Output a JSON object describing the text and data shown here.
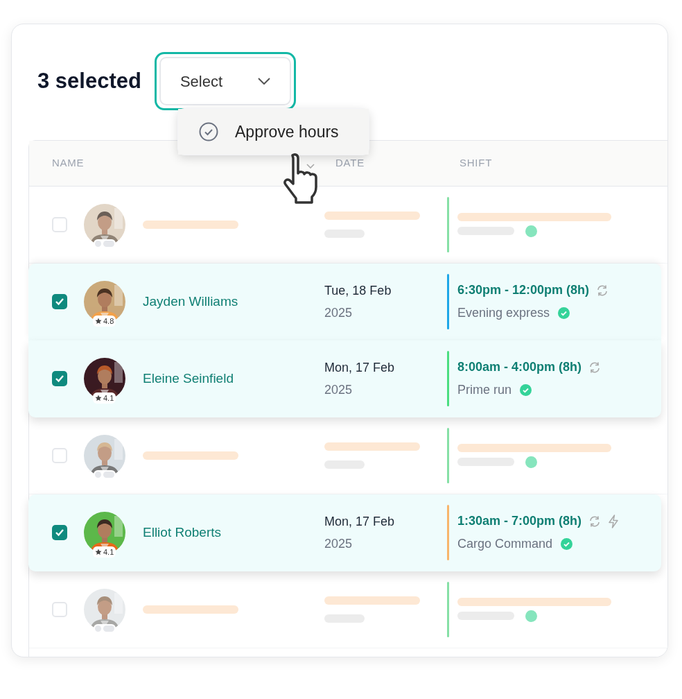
{
  "heading": "3 selected",
  "select": {
    "label": "Select",
    "focused": true
  },
  "menu": {
    "items": [
      {
        "label": "Approve hours"
      }
    ]
  },
  "table": {
    "columns": [
      {
        "label": "NAME"
      },
      {
        "label": "DATE"
      },
      {
        "label": "SHIFT"
      }
    ],
    "rows": [
      {
        "kind": "placeholder",
        "selected": false,
        "color": "#86e0a6"
      },
      {
        "kind": "entry",
        "selected": true,
        "name": "Jayden Williams",
        "rating": "4.8",
        "date": "Tue, 18 Feb",
        "year": "2025",
        "time": "6:30pm - 12:00pm (8h)",
        "shift": "Evening express",
        "approved": true,
        "color": "#1ea7e8",
        "icons": [
          {
            "kind": "repeat"
          }
        ]
      },
      {
        "kind": "entry",
        "selected": true,
        "name": "Eleine Seinfield",
        "rating": "4.1",
        "date": "Mon, 17 Feb",
        "year": "2025",
        "time": "8:00am - 4:00pm (8h)",
        "shift": "Prime run",
        "approved": true,
        "color": "#4ade80",
        "icons": [
          {
            "kind": "repeat"
          }
        ]
      },
      {
        "kind": "placeholder",
        "selected": false,
        "color": "#86e0a6"
      },
      {
        "kind": "entry",
        "selected": true,
        "name": "Elliot Roberts",
        "rating": "4.1",
        "date": "Mon, 17 Feb",
        "year": "2025",
        "time": "1:30am - 7:00pm (8h)",
        "shift": "Cargo Command",
        "approved": true,
        "color": "#f8b56b",
        "icons": [
          {
            "kind": "repeat"
          },
          {
            "kind": "bolt"
          }
        ]
      },
      {
        "kind": "placeholder",
        "selected": false,
        "color": "#86e0a6"
      }
    ]
  }
}
